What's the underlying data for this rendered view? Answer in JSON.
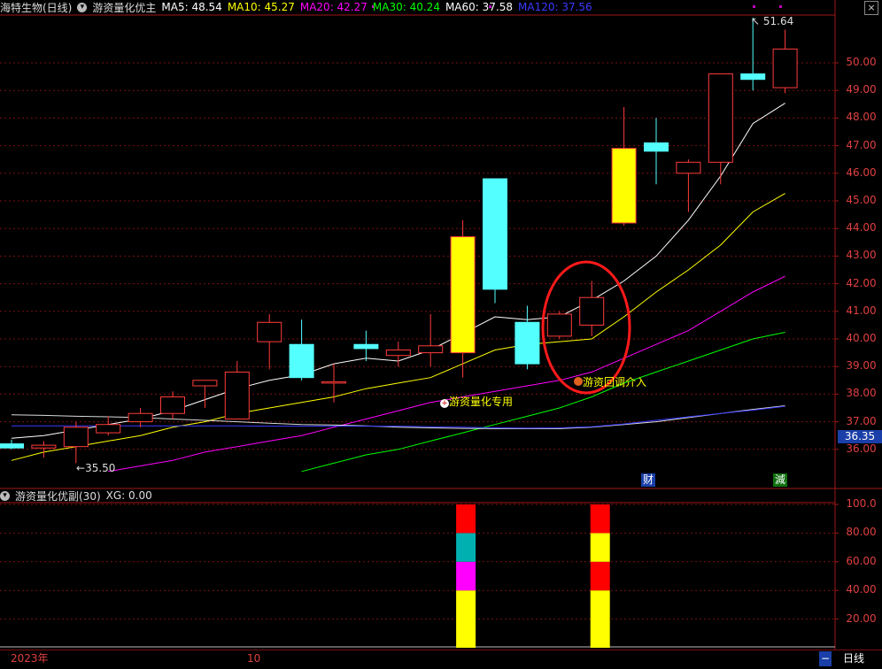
{
  "header": {
    "stock_name": "海特生物(日线)",
    "indicator_name": "游资量化优主",
    "ma": [
      {
        "label": "MA5: 48.54",
        "color": "#ffffff"
      },
      {
        "label": "MA10: 45.27",
        "color": "#ffff00"
      },
      {
        "label": "MA20: 42.27",
        "color": "#ff00ff"
      },
      {
        "label": "MA30: 40.24",
        "color": "#00ff00"
      },
      {
        "label": "MA60: 37.58",
        "color": "#ffffff"
      },
      {
        "label": "MA120: 37.56",
        "color": "#3a3aff"
      }
    ]
  },
  "sub_header": {
    "indicator": "游资量化优副(30)",
    "xg": "XG: 0.00"
  },
  "price_axis": [
    "50.00",
    "49.00",
    "48.00",
    "47.00",
    "46.00",
    "45.00",
    "44.00",
    "43.00",
    "42.00",
    "41.00",
    "40.00",
    "39.00",
    "38.00",
    "37.00",
    "36.00"
  ],
  "current_price": "36.35",
  "sub_axis": [
    "100.0",
    "80.00",
    "60.00",
    "40.00",
    "20.00"
  ],
  "annotations": {
    "high": "51.64",
    "low": "35.50",
    "signal1": "游资量化专用",
    "signal2": "游资回调介入",
    "cai": "财",
    "jian": "減"
  },
  "time_axis": {
    "year": "2023年",
    "month": "10"
  },
  "bottom": {
    "minus": "−",
    "period": "日线"
  },
  "chart_data": {
    "type": "candlestick",
    "candles": [
      {
        "o": 36.2,
        "h": 36.35,
        "l": 36.0,
        "c": 36.05
      },
      {
        "o": 36.05,
        "h": 36.3,
        "l": 35.7,
        "c": 36.15
      },
      {
        "o": 36.1,
        "h": 37.0,
        "l": 35.5,
        "c": 36.8
      },
      {
        "o": 36.6,
        "h": 37.2,
        "l": 36.5,
        "c": 36.9
      },
      {
        "o": 37.0,
        "h": 37.5,
        "l": 36.8,
        "c": 37.3
      },
      {
        "o": 37.3,
        "h": 38.1,
        "l": 37.1,
        "c": 37.9
      },
      {
        "o": 38.3,
        "h": 38.4,
        "l": 37.5,
        "c": 38.5
      },
      {
        "o": 37.1,
        "h": 39.2,
        "l": 37.5,
        "c": 38.8
      },
      {
        "o": 39.9,
        "h": 40.9,
        "l": 38.9,
        "c": 40.6
      },
      {
        "o": 39.8,
        "h": 40.7,
        "l": 38.5,
        "c": 38.6
      },
      {
        "o": 38.4,
        "h": 39.1,
        "l": 37.7,
        "c": 38.45
      },
      {
        "o": 39.8,
        "h": 40.3,
        "l": 39.2,
        "c": 39.65
      },
      {
        "o": 39.4,
        "h": 39.9,
        "l": 39.0,
        "c": 39.6
      },
      {
        "o": 39.5,
        "h": 40.9,
        "l": 39.0,
        "c": 39.75
      },
      {
        "o": 39.5,
        "h": 44.3,
        "l": 38.6,
        "c": 43.7
      },
      {
        "o": 45.8,
        "h": 45.8,
        "l": 41.3,
        "c": 41.8
      },
      {
        "o": 40.6,
        "h": 41.2,
        "l": 38.9,
        "c": 39.1
      },
      {
        "o": 40.1,
        "h": 41.0,
        "l": 40.0,
        "c": 40.9
      },
      {
        "o": 40.5,
        "h": 42.1,
        "l": 40.1,
        "c": 41.5
      },
      {
        "o": 44.2,
        "h": 48.4,
        "l": 44.1,
        "c": 46.9
      },
      {
        "o": 47.1,
        "h": 48.0,
        "l": 45.6,
        "c": 46.8
      },
      {
        "o": 46.0,
        "h": 46.5,
        "l": 44.6,
        "c": 46.4
      },
      {
        "o": 46.4,
        "h": 49.6,
        "l": 45.6,
        "c": 49.6
      },
      {
        "o": 49.6,
        "h": 51.64,
        "l": 49.0,
        "c": 49.4
      },
      {
        "o": 49.1,
        "h": 51.2,
        "l": 48.9,
        "c": 50.5
      }
    ],
    "ma_series": [
      {
        "name": "MA5",
        "color": "#ffffff",
        "values": [
          36.4,
          36.5,
          36.7,
          36.9,
          37.1,
          37.4,
          37.8,
          38.2,
          38.5,
          38.7,
          39.1,
          39.3,
          39.2,
          39.6,
          40.2,
          40.8,
          40.7,
          40.8,
          41.4,
          42.1,
          43.0,
          44.3,
          45.9,
          47.8,
          48.54
        ]
      },
      {
        "name": "MA10",
        "color": "#ffff00",
        "values": [
          35.6,
          35.9,
          36.1,
          36.3,
          36.5,
          36.8,
          37.0,
          37.3,
          37.5,
          37.7,
          37.9,
          38.2,
          38.4,
          38.6,
          39.1,
          39.6,
          39.8,
          39.9,
          40.0,
          40.8,
          41.7,
          42.5,
          43.4,
          44.6,
          45.27
        ]
      },
      {
        "name": "MA20",
        "color": "#ff00ff",
        "values": [
          null,
          null,
          null,
          35.2,
          35.4,
          35.6,
          35.9,
          36.1,
          36.3,
          36.5,
          36.8,
          37.1,
          37.4,
          37.7,
          37.9,
          38.1,
          38.3,
          38.5,
          38.8,
          39.3,
          39.8,
          40.3,
          41.0,
          41.7,
          42.27
        ]
      },
      {
        "name": "MA30",
        "color": "#00ff00",
        "values": [
          null,
          null,
          null,
          null,
          null,
          null,
          null,
          null,
          null,
          35.2,
          35.5,
          35.8,
          36.0,
          36.3,
          36.6,
          36.9,
          37.2,
          37.5,
          37.9,
          38.4,
          38.8,
          39.2,
          39.6,
          40.0,
          40.24
        ]
      },
      {
        "name": "MA60",
        "color": "#ffffff",
        "values": [
          37.25,
          37.23,
          37.2,
          37.18,
          37.15,
          37.1,
          37.05,
          37.0,
          36.95,
          36.9,
          36.88,
          36.85,
          36.8,
          36.78,
          36.76,
          36.75,
          36.75,
          36.75,
          36.8,
          36.9,
          37.0,
          37.15,
          37.3,
          37.45,
          37.58
        ]
      },
      {
        "name": "MA120",
        "color": "#3a3aff",
        "values": [
          36.85,
          36.85,
          36.85,
          36.85,
          36.85,
          36.85,
          36.85,
          36.85,
          36.84,
          36.84,
          36.84,
          36.84,
          36.84,
          36.82,
          36.8,
          36.78,
          36.77,
          36.78,
          36.82,
          36.92,
          37.05,
          37.18,
          37.3,
          37.42,
          37.56
        ]
      }
    ],
    "sub_bars": [
      {
        "index": 14,
        "segments": [
          {
            "from": 0,
            "to": 40,
            "color": "#ffff00"
          },
          {
            "from": 40,
            "to": 60,
            "color": "#ff00ff"
          },
          {
            "from": 60,
            "to": 80,
            "color": "#00b0b0"
          },
          {
            "from": 80,
            "to": 100,
            "color": "#ff0000"
          }
        ]
      },
      {
        "index": 18,
        "segments": [
          {
            "from": 0,
            "to": 40,
            "color": "#ffff00"
          },
          {
            "from": 40,
            "to": 60,
            "color": "#ff0000"
          },
          {
            "from": 60,
            "to": 80,
            "color": "#ffff00"
          },
          {
            "from": 80,
            "to": 100,
            "color": "#ff0000"
          }
        ]
      }
    ],
    "ylim": [
      35.0,
      51.9
    ],
    "sub_ylim": [
      0,
      100
    ]
  }
}
